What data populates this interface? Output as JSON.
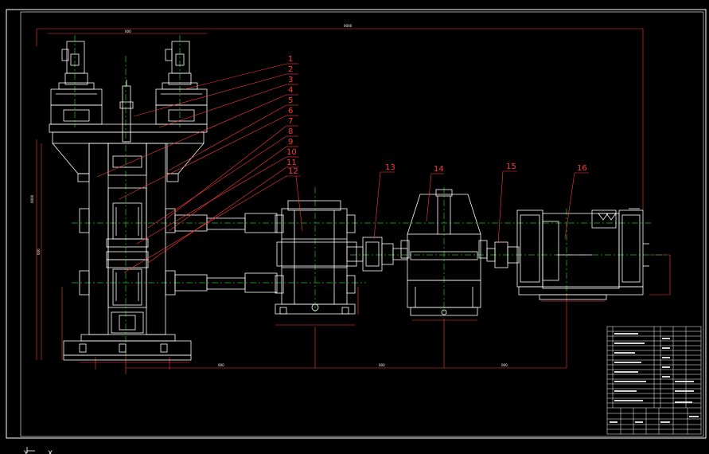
{
  "colors": {
    "background": "#000000",
    "outline": "#ffffff",
    "centerline": "#22c022",
    "callout": "#ff2a2a",
    "border": "#ffffff"
  },
  "callouts": {
    "roll_stand": [
      "1",
      "2",
      "3",
      "4",
      "5",
      "6",
      "7",
      "8",
      "9",
      "10",
      "11",
      "12"
    ],
    "drive_train": [
      "13",
      "14",
      "15",
      "16"
    ]
  },
  "ucs": {
    "y": "Y",
    "x": "X"
  }
}
